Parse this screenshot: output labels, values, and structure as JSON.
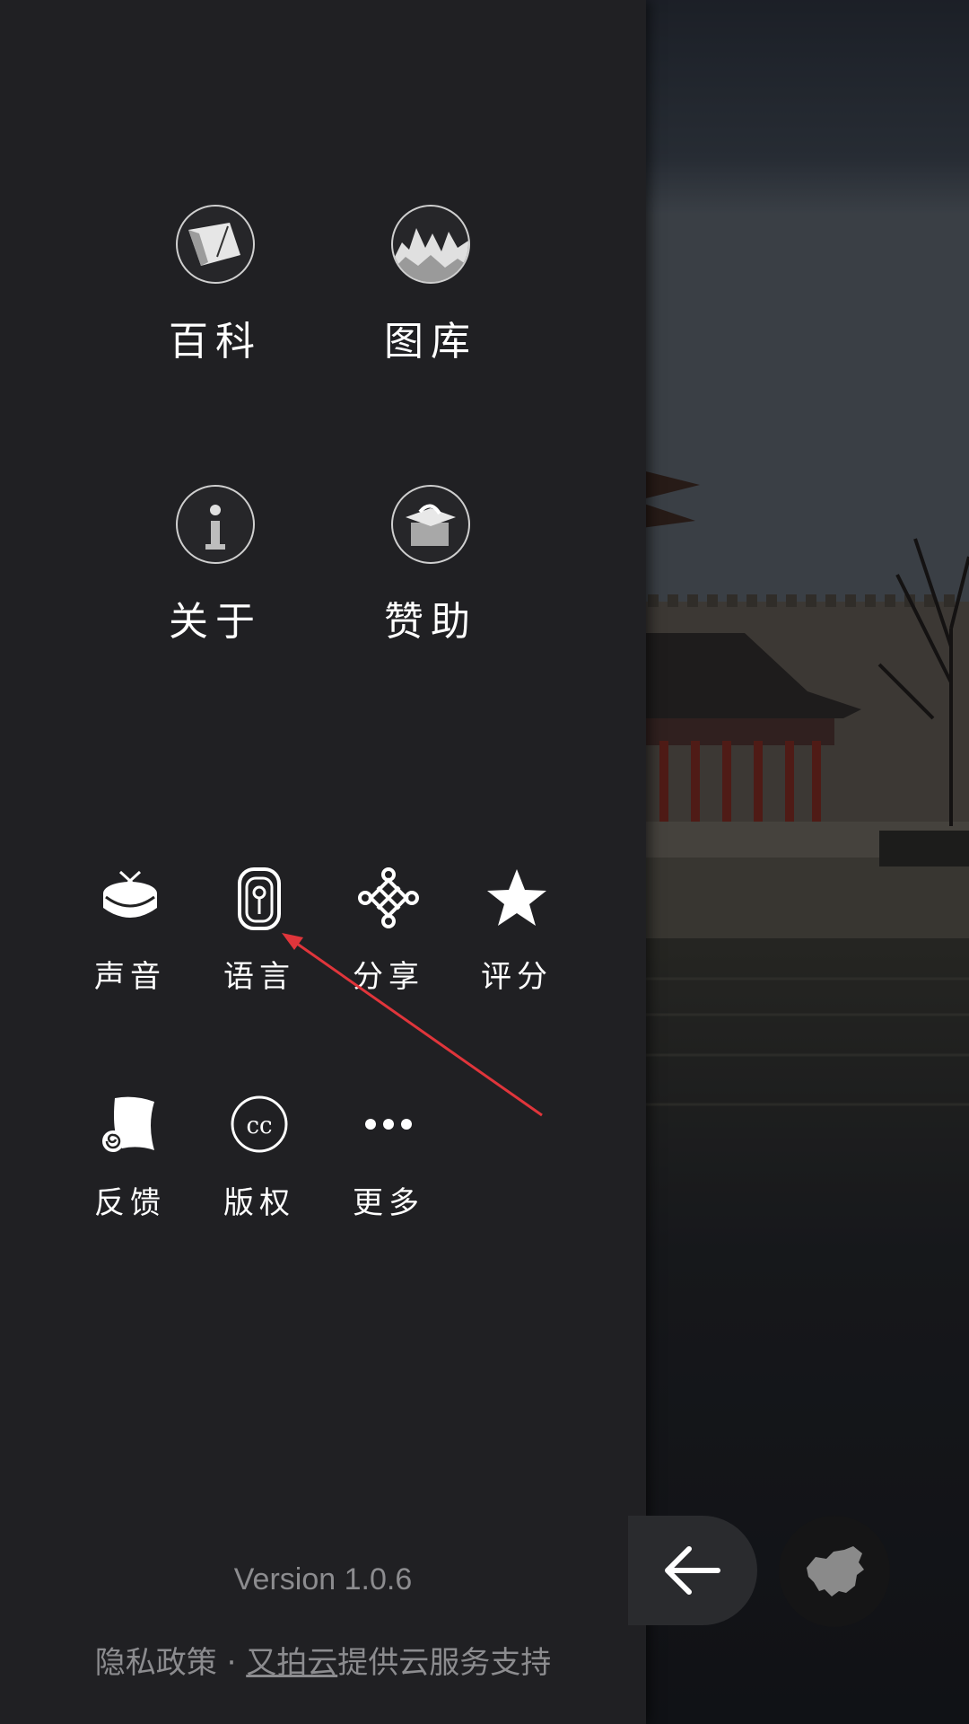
{
  "drawer": {
    "main_items": [
      {
        "label": "百科",
        "icon": "encyclopedia-scroll-icon"
      },
      {
        "label": "图库",
        "icon": "gallery-mountains-icon"
      },
      {
        "label": "关于",
        "icon": "info-icon"
      },
      {
        "label": "赞助",
        "icon": "sponsor-box-icon"
      }
    ],
    "secondary_items": [
      {
        "label": "声音",
        "icon": "drum-icon"
      },
      {
        "label": "语言",
        "icon": "language-seal-icon"
      },
      {
        "label": "分享",
        "icon": "chinese-knot-icon"
      },
      {
        "label": "评分",
        "icon": "star-icon"
      },
      {
        "label": "反馈",
        "icon": "feedback-scroll-icon"
      },
      {
        "label": "版权",
        "icon": "creative-commons-icon"
      },
      {
        "label": "更多",
        "icon": "more-dots-icon"
      }
    ],
    "version": "Version 1.0.6",
    "footer": {
      "prefix": "隐私政策 · ",
      "link": "又拍云",
      "suffix": "提供云服务支持"
    }
  },
  "floating": {
    "back_icon": "arrow-left-icon",
    "map_icon": "china-map-icon"
  },
  "colors": {
    "drawer_bg": "#202023",
    "text": "#ffffff",
    "muted_text": "#8c8c8f",
    "annotation": "#e0353b"
  }
}
